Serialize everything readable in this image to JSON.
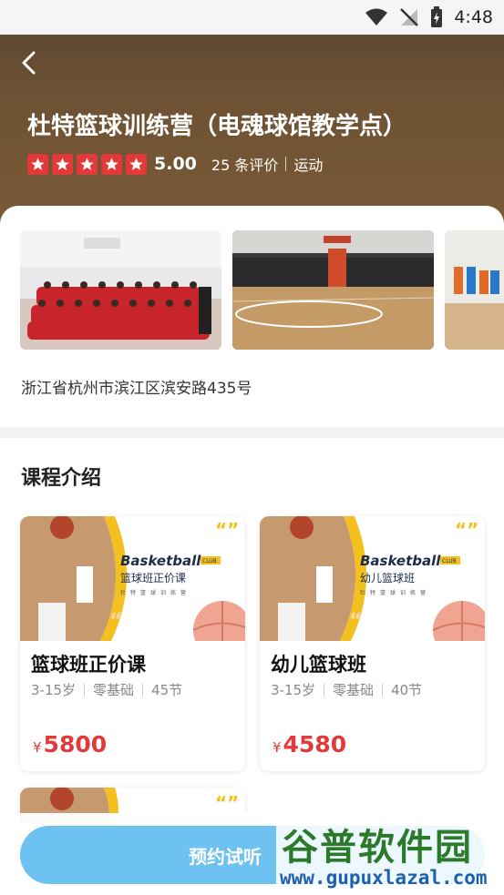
{
  "status_bar": {
    "time": "4:48"
  },
  "header": {
    "title": "杜特篮球训练营（电魂球馆教学点）",
    "rating": "5.00",
    "reviews": "25 条评价",
    "category": "运动"
  },
  "venue": {
    "address": "浙江省杭州市滨江区滨安路435号"
  },
  "courses": {
    "section_title": "课程介绍",
    "items": [
      {
        "name": "篮球班正价课",
        "age": "3-15岁",
        "level": "零基础",
        "lessons": "45节",
        "currency": "¥",
        "price": "5800",
        "banner_title": "Basketball",
        "banner_badge": "CLUB",
        "banner_subtitle": "篮球班正价课",
        "banner_org": "杜特篮球训练营"
      },
      {
        "name": "幼儿篮球班",
        "age": "3-15岁",
        "level": "零基础",
        "lessons": "40节",
        "currency": "¥",
        "price": "4580",
        "banner_title": "Basketball",
        "banner_badge": "CLUB",
        "banner_subtitle": "幼儿篮球班",
        "banner_org": "杜特篮球训练营"
      }
    ]
  },
  "bottom": {
    "book_label": "预约试听"
  },
  "watermark": {
    "name": "谷普软件园",
    "url": "www.gupuxlazal.com"
  },
  "colors": {
    "accent_blue": "#6ec2f2",
    "price_red": "#e23a3a",
    "star_red": "#e23a3a"
  }
}
